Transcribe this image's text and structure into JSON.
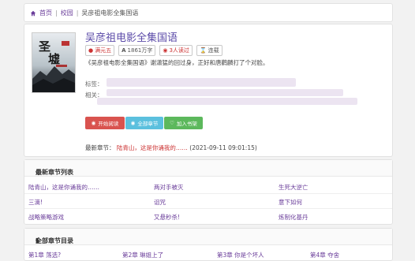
{
  "breadcrumb": {
    "home": "首页",
    "section": "校园",
    "current": "吴彦祖电影全集国语"
  },
  "book": {
    "title": "吴彦祖电影全集国语",
    "tags": [
      {
        "icon": "user-icon",
        "label": "满元五",
        "color": "#c33"
      },
      {
        "icon": "font-icon",
        "label": "1861万字",
        "color": "#444"
      },
      {
        "icon": "eye-icon",
        "label": "3人读过",
        "color": "#c33"
      },
      {
        "icon": "hourglass-icon",
        "label": "连载",
        "color": "#444"
      }
    ],
    "description": "《吴彦祖电影全集国语》谢潇猛的回过身，正好和唐鹳麟打了个对脸。",
    "tags_label": "标签：",
    "related_label": "相关："
  },
  "actions": {
    "read": "开始阅读",
    "all_chapters": "全部章节",
    "bookshelf": "加入书架"
  },
  "latest": {
    "label": "最新章节：",
    "chapter": "陆青山，这是你诵我的……",
    "time": "(2021-09-11 09:01:15)"
  },
  "latest_list": {
    "heading": "最新章节列表",
    "items": [
      "陆青山，这是你诵我的……",
      "两对手被灭",
      "生死大逆亡",
      "三滴!",
      "诅咒",
      "意下如何",
      "战略策略游戏",
      "又悬秒杀!",
      "炼制化基丹"
    ]
  },
  "all_list": {
    "heading": "全部章节目录",
    "items": [
      "第1章 荡选?",
      "第2章 琳姐上了",
      "第3章 你是个坏人",
      "第4章 夺舍"
    ]
  },
  "colors": {
    "red": "#d9534f",
    "blue": "#5bc0de",
    "green": "#5cb85c",
    "accent": "#5b4aa8"
  }
}
